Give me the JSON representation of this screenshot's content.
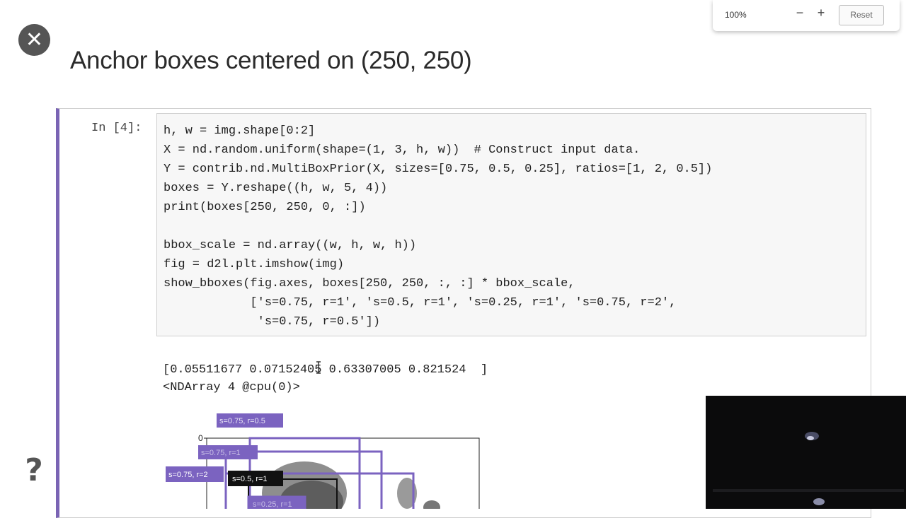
{
  "slide": {
    "title": "Anchor boxes centered on (250, 250)"
  },
  "zoom": {
    "level": "100%",
    "minus": "−",
    "plus": "+",
    "reset": "Reset"
  },
  "buttons": {
    "close_symbol": "✕",
    "help_symbol": "?"
  },
  "cell": {
    "prompt": "In [4]:",
    "code": [
      "h, w = img.shape[0:2]",
      "X = nd.random.uniform(shape=(1, 3, h, w))  # Construct input data.",
      "Y = contrib.nd.MultiBoxPrior(X, sizes=[0.75, 0.5, 0.25], ratios=[1, 2, 0.5])",
      "boxes = Y.reshape((h, w, 5, 4))",
      "print(boxes[250, 250, 0, :])",
      "",
      "bbox_scale = nd.array((w, h, w, h))",
      "fig = d2l.plt.imshow(img)",
      "show_bboxes(fig.axes, boxes[250, 250, :, :] * bbox_scale,",
      "            ['s=0.75, r=1', 's=0.5, r=1', 's=0.25, r=1', 's=0.75, r=2',",
      "             's=0.75, r=0.5'])"
    ],
    "output": [
      "[0.05511677 0.07152405 0.63307005 0.821524  ]",
      "<NDArray 4 @cpu(0)>"
    ]
  },
  "plot": {
    "ytick": "0",
    "box_labels": [
      "s=0.75, r=0.5",
      "s=0.75, r=1",
      "s=0.75, r=2",
      "s=0.5, r=1",
      "s=0.25, r=1"
    ],
    "colors": {
      "purple": "#7b63c0",
      "black": "#111111"
    }
  }
}
